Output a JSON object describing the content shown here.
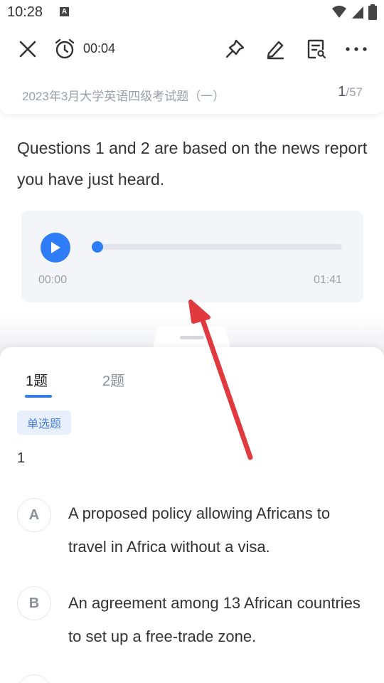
{
  "status_bar": {
    "time": "10:28",
    "notif": "A"
  },
  "toolbar": {
    "timer": "00:04",
    "icons": [
      "close-icon",
      "alarm-icon",
      "pin-icon",
      "pencil-icon",
      "answer-sheet-icon",
      "more-icon"
    ]
  },
  "header": {
    "exam_title": "2023年3月大学英语四级考试题（一）",
    "current": "1",
    "total": "/57"
  },
  "question": {
    "prompt": "Questions 1 and 2 are based on the news report you have just heard."
  },
  "audio": {
    "start": "00:00",
    "end": "01:41",
    "progress": 0
  },
  "tabs": [
    {
      "label": "1题",
      "active": true
    },
    {
      "label": "2题",
      "active": false
    }
  ],
  "sub_question": {
    "type_badge": "单选题",
    "number": "1",
    "options": [
      {
        "letter": "A",
        "text": "A proposed policy allowing Africans to travel in Africa without a visa."
      },
      {
        "letter": "B",
        "text": "An agreement among 13 African countries to set up a free-trade zone."
      }
    ]
  },
  "colors": {
    "accent": "#2f7df6",
    "annotation_arrow": "#e0393e"
  }
}
